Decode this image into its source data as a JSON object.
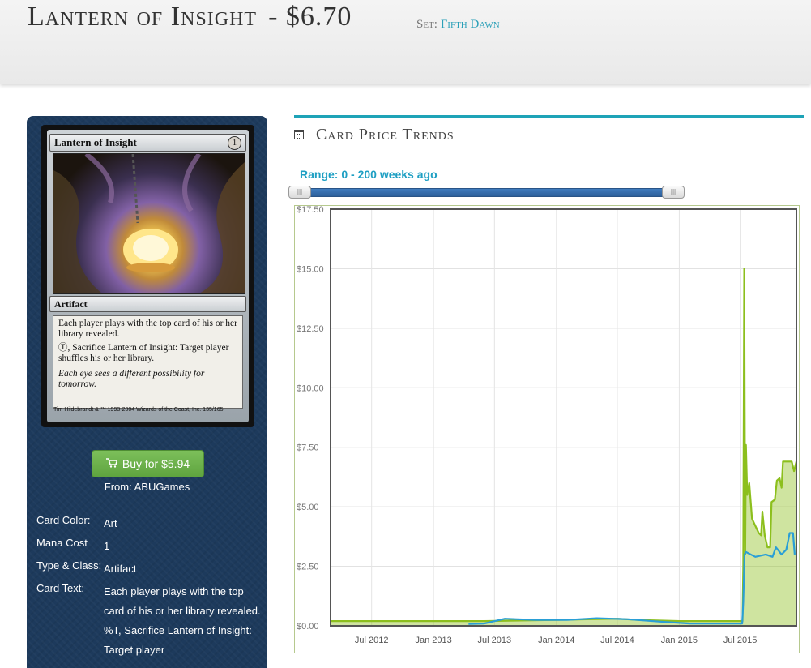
{
  "header": {
    "card_name": "Lantern of Insight",
    "price": "- $6.70",
    "set_label": "Set:",
    "set_name": "Fifth Dawn"
  },
  "card_image": {
    "name": "Lantern of Insight",
    "mana_cost": "1",
    "type_line": "Artifact",
    "rules_text_1": "Each player plays with the top card of his or her library revealed.",
    "rules_text_2": "Ⓣ, Sacrifice Lantern of Insight: Target player shuffles his or her library.",
    "flavor_text": "Each eye sees a different possibility for tomorrow.",
    "artist_footer": "Tim Hildebrandt",
    "copyright": "& ™ 1993-2004 Wizards of the Coast, Inc. 135/165"
  },
  "buy": {
    "cart_icon": "shopping-cart-icon",
    "label": "Buy for $5.94",
    "from": "From: ABUGames"
  },
  "details": {
    "rows": [
      {
        "label": "Card Color:",
        "value": "Art"
      },
      {
        "label": "Mana Cost",
        "value": "1"
      },
      {
        "label": "Type & Class:",
        "value": "Artifact"
      },
      {
        "label": "Card Text:",
        "value": "Each player plays with the top card of his or her library revealed. %T, Sacrifice Lantern of Insight: Target player"
      }
    ]
  },
  "trends": {
    "icon": "calendar-icon",
    "title": "Card Price Trends",
    "range_label": "Range: 0 - 200 weeks ago",
    "slider_min_fraction": 0,
    "slider_max_fraction": 1,
    "colors": {
      "accent": "#1ea3b7",
      "series_green": "#8cbf1d",
      "series_blue": "#2a9fd6"
    }
  },
  "chart_data": {
    "type": "area",
    "x_tick_labels": [
      "Jul 2012",
      "Jan 2013",
      "Jul 2013",
      "Jan 2014",
      "Jul 2014",
      "Jan 2015",
      "Jul 2015"
    ],
    "y_tick_labels": [
      "$0.00",
      "$2.50",
      "$5.00",
      "$7.50",
      "$10.00",
      "$12.50",
      "$15.00",
      "$17.50"
    ],
    "ylim": [
      0,
      17.5
    ],
    "xlim": [
      "2012-03-01",
      "2015-12-15"
    ],
    "grid": true,
    "series": [
      {
        "style": "area",
        "color": "#8cbf1d",
        "points": [
          [
            "2012-03-01",
            0.2
          ],
          [
            "2012-09-01",
            0.2
          ],
          [
            "2013-01-01",
            0.2
          ],
          [
            "2013-06-01",
            0.2
          ],
          [
            "2013-09-01",
            0.22
          ],
          [
            "2014-01-01",
            0.25
          ],
          [
            "2014-07-01",
            0.3
          ],
          [
            "2014-09-01",
            0.25
          ],
          [
            "2015-01-01",
            0.2
          ],
          [
            "2015-06-15",
            0.2
          ],
          [
            "2015-07-08",
            0.2
          ],
          [
            "2015-07-10",
            2.5
          ],
          [
            "2015-07-13",
            15.0
          ],
          [
            "2015-07-16",
            3.0
          ],
          [
            "2015-07-18",
            7.6
          ],
          [
            "2015-07-22",
            5.5
          ],
          [
            "2015-07-28",
            6.0
          ],
          [
            "2015-08-05",
            4.5
          ],
          [
            "2015-08-15",
            4.2
          ],
          [
            "2015-08-25",
            3.9
          ],
          [
            "2015-09-01",
            3.8
          ],
          [
            "2015-09-05",
            4.8
          ],
          [
            "2015-09-12",
            3.8
          ],
          [
            "2015-09-20",
            3.3
          ],
          [
            "2015-09-28",
            3.3
          ],
          [
            "2015-10-02",
            5.2
          ],
          [
            "2015-10-12",
            5.3
          ],
          [
            "2015-10-18",
            6.1
          ],
          [
            "2015-10-26",
            6.2
          ],
          [
            "2015-11-01",
            5.8
          ],
          [
            "2015-11-05",
            6.9
          ],
          [
            "2015-11-20",
            6.9
          ],
          [
            "2015-12-01",
            6.9
          ],
          [
            "2015-12-08",
            6.5
          ],
          [
            "2015-12-15",
            6.9
          ]
        ]
      },
      {
        "style": "line",
        "color": "#2a9fd6",
        "points": [
          [
            "2013-04-15",
            0.08
          ],
          [
            "2013-06-01",
            0.1
          ],
          [
            "2013-08-01",
            0.3
          ],
          [
            "2013-11-01",
            0.25
          ],
          [
            "2014-02-01",
            0.25
          ],
          [
            "2014-05-01",
            0.32
          ],
          [
            "2014-08-01",
            0.28
          ],
          [
            "2014-11-01",
            0.18
          ],
          [
            "2015-02-01",
            0.1
          ],
          [
            "2015-05-01",
            0.1
          ],
          [
            "2015-07-07",
            0.1
          ],
          [
            "2015-07-10",
            1.0
          ],
          [
            "2015-07-14",
            3.0
          ],
          [
            "2015-07-18",
            3.1
          ],
          [
            "2015-08-15",
            2.9
          ],
          [
            "2015-09-15",
            3.0
          ],
          [
            "2015-10-05",
            2.9
          ],
          [
            "2015-10-15",
            3.3
          ],
          [
            "2015-11-01",
            3.0
          ],
          [
            "2015-11-15",
            3.2
          ],
          [
            "2015-11-25",
            3.9
          ],
          [
            "2015-12-05",
            3.9
          ],
          [
            "2015-12-10",
            3.0
          ]
        ]
      }
    ]
  }
}
